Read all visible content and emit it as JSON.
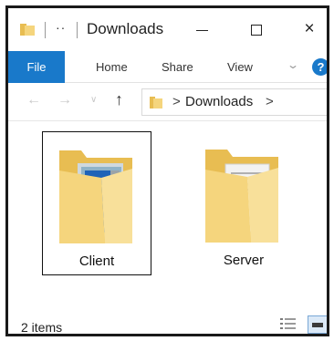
{
  "titlebar": {
    "quick_access": "··",
    "title": "Downloads",
    "close_label": "×"
  },
  "ribbon": {
    "tabs": [
      "File",
      "Home",
      "Share",
      "View"
    ],
    "help_label": "?"
  },
  "navigation": {
    "path_separator": ">",
    "path": [
      "Downloads"
    ]
  },
  "items": [
    {
      "name": "Client",
      "selected": true
    },
    {
      "name": "Server",
      "selected": false
    }
  ],
  "status": {
    "item_count": "2 items"
  },
  "colors": {
    "accent": "#1979ca",
    "folder": "#f5d57d",
    "folder_dark": "#e8bd52"
  }
}
